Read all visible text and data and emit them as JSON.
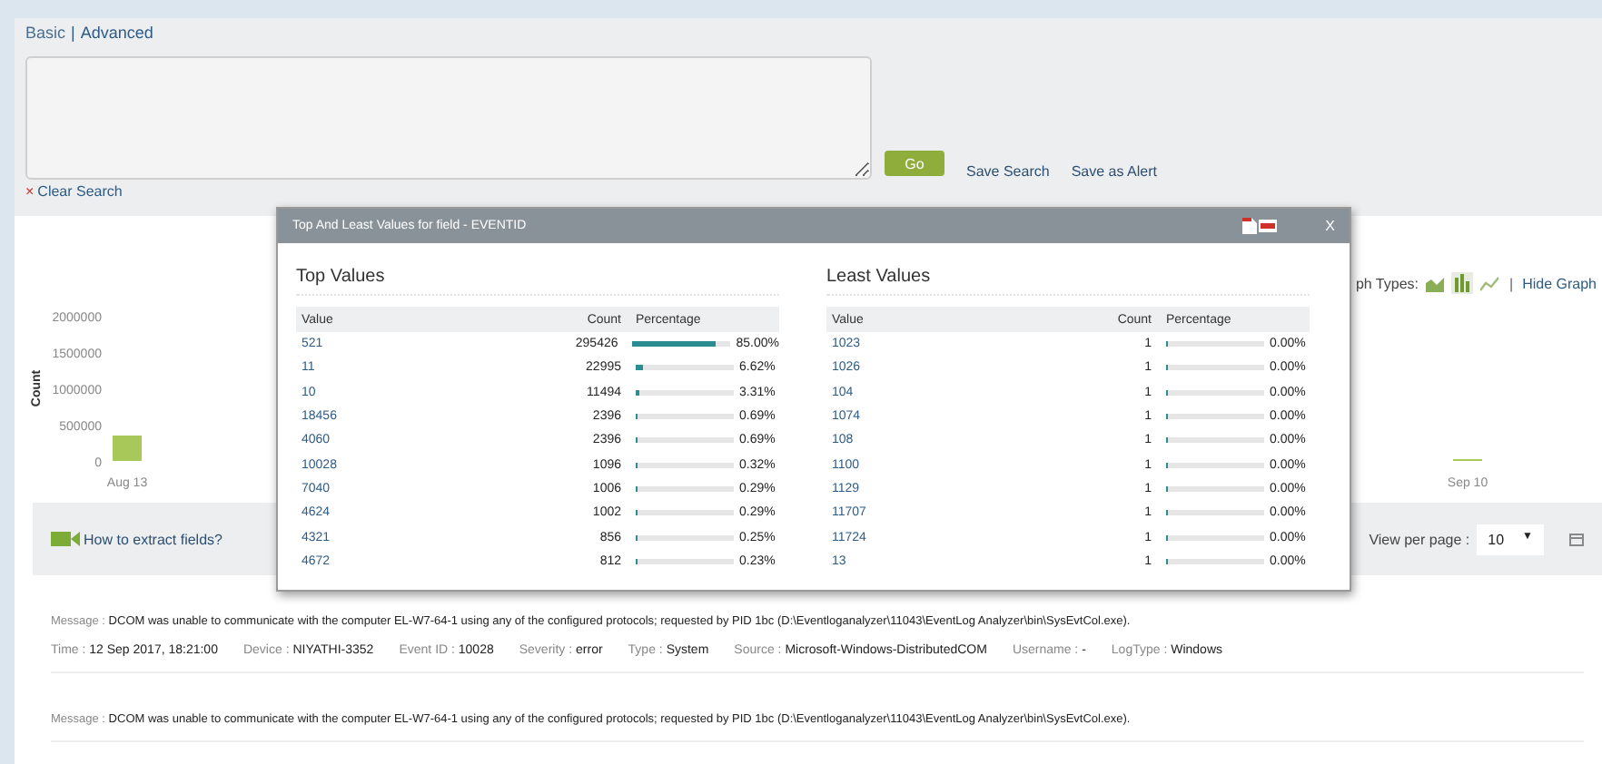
{
  "search": {
    "modes": [
      {
        "label": "Basic",
        "selected": false
      },
      {
        "label": "Advanced",
        "selected": true
      }
    ],
    "separator": "|",
    "go": "Go",
    "clear_icon": "×",
    "clear": "Clear Search",
    "links": [
      "Save Search",
      "Save as Alert"
    ]
  },
  "graph": {
    "types_label": "ph Types:",
    "types": [
      {
        "kind": "area",
        "selected": false
      },
      {
        "kind": "bar",
        "selected": true
      },
      {
        "kind": "line",
        "selected": false
      }
    ],
    "separator": "|",
    "hide": "Hide Graph",
    "chart_data": {
      "type": "bar",
      "ylabel": "Count",
      "categories": [
        "Aug 13",
        "Sep 10"
      ],
      "values": [
        350000,
        0
      ],
      "ylim": [
        0,
        2000000
      ],
      "yticks": [
        0,
        500000,
        1000000,
        1500000,
        2000000
      ]
    }
  },
  "toolbar": {
    "help": "How to extract fields?",
    "per_page_label": "View per page :",
    "per_page": "10",
    "caret": "▼"
  },
  "records": [
    {
      "message_label": "Message :",
      "message": "DCOM was unable to communicate with the computer EL-W7-64-1 using any of the configured protocols; requested by PID 1bc (D:\\Eventloganalyzer\\11043\\EventLog Analyzer\\bin\\SysEvtCol.exe).",
      "fields": [
        {
          "label": "Time :",
          "value": "12 Sep 2017, 18:21:00"
        },
        {
          "label": "Device :",
          "value": "NIYATHI-3352"
        },
        {
          "label": "Event ID :",
          "value": "10028"
        },
        {
          "label": "Severity :",
          "value": "error"
        },
        {
          "label": "Type :",
          "value": "System"
        },
        {
          "label": "Source :",
          "value": "Microsoft-Windows-DistributedCOM"
        },
        {
          "label": "Username :",
          "value": "-"
        },
        {
          "label": "LogType :",
          "value": "Windows"
        }
      ]
    },
    {
      "message_label": "Message :",
      "message": "DCOM was unable to communicate with the computer EL-W7-64-1 using any of the configured protocols; requested by PID 1bc (D:\\Eventloganalyzer\\11043\\EventLog Analyzer\\bin\\SysEvtCol.exe)."
    }
  ],
  "modal": {
    "title": "Top And Least Values for field - EVENTID",
    "close": "X",
    "sections": [
      {
        "title": "Top Values",
        "columns": [
          "Value",
          "Count",
          "Percentage"
        ],
        "rows": [
          {
            "value": "521",
            "count": "295426",
            "level": 0.85,
            "percent": "85.00%"
          },
          {
            "value": "11",
            "count": "22995",
            "level": 0.0662,
            "percent": "6.62%"
          },
          {
            "value": "10",
            "count": "11494",
            "level": 0.0331,
            "percent": "3.31%"
          },
          {
            "value": "18456",
            "count": "2396",
            "level": 0.0069,
            "percent": "0.69%"
          },
          {
            "value": "4060",
            "count": "2396",
            "level": 0.0069,
            "percent": "0.69%"
          },
          {
            "value": "10028",
            "count": "1096",
            "level": 0.0032,
            "percent": "0.32%"
          },
          {
            "value": "7040",
            "count": "1006",
            "level": 0.0029,
            "percent": "0.29%"
          },
          {
            "value": "4624",
            "count": "1002",
            "level": 0.0029,
            "percent": "0.29%"
          },
          {
            "value": "4321",
            "count": "856",
            "level": 0.0025,
            "percent": "0.25%"
          },
          {
            "value": "4672",
            "count": "812",
            "level": 0.0023,
            "percent": "0.23%"
          }
        ]
      },
      {
        "title": "Least Values",
        "columns": [
          "Value",
          "Count",
          "Percentage"
        ],
        "rows": [
          {
            "value": "1023",
            "count": "1",
            "level": 0,
            "percent": "0.00%"
          },
          {
            "value": "1026",
            "count": "1",
            "level": 0,
            "percent": "0.00%"
          },
          {
            "value": "104",
            "count": "1",
            "level": 0,
            "percent": "0.00%"
          },
          {
            "value": "1074",
            "count": "1",
            "level": 0,
            "percent": "0.00%"
          },
          {
            "value": "108",
            "count": "1",
            "level": 0,
            "percent": "0.00%"
          },
          {
            "value": "1100",
            "count": "1",
            "level": 0,
            "percent": "0.00%"
          },
          {
            "value": "1129",
            "count": "1",
            "level": 0,
            "percent": "0.00%"
          },
          {
            "value": "11707",
            "count": "1",
            "level": 0,
            "percent": "0.00%"
          },
          {
            "value": "11724",
            "count": "1",
            "level": 0,
            "percent": "0.00%"
          },
          {
            "value": "13",
            "count": "1",
            "level": 0,
            "percent": "0.00%"
          }
        ]
      }
    ]
  }
}
